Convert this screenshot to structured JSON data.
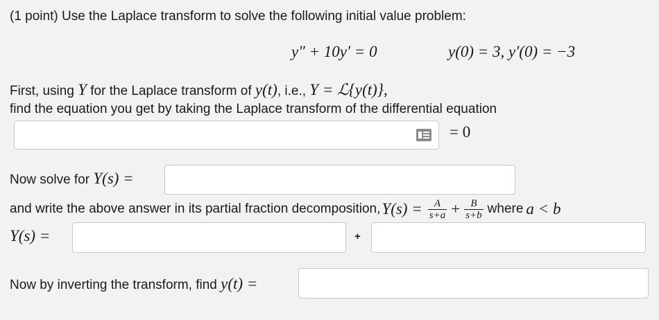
{
  "problem": {
    "intro": "(1 point) Use the Laplace transform to solve the following initial value problem:",
    "ode": "y″ + 10y′ = 0",
    "initial_conditions": "y(0) = 3,  y′(0) = −3"
  },
  "step1": {
    "line1_a": "First, using ",
    "Y": "Y",
    "line1_b": " for the Laplace transform of ",
    "yt": "y(t)",
    "line1_c": ", i.e., ",
    "def": "Y = ℒ{y(t)},",
    "line2": "find the equation you get by taking the Laplace transform of the differential equation",
    "equals_zero": "= 0",
    "input_value": ""
  },
  "step2": {
    "label_text": "Now solve for ",
    "label_math": "Y(s) =",
    "input_value": ""
  },
  "step3": {
    "text_a": "and write the above answer in its partial fraction decomposition, ",
    "Ys_eq": "Y(s) =",
    "frac1_num": "A",
    "frac1_den": "s+a",
    "plus": "+",
    "frac2_num": "B",
    "frac2_den": "s+b",
    "where_text": "where ",
    "condition": "a < b",
    "row_label": "Y(s) =",
    "plus_between": "+",
    "input1_value": "",
    "input2_value": ""
  },
  "step4": {
    "label_text": "Now by inverting the transform, find ",
    "label_math": "y(t) =",
    "input_value": ""
  },
  "icons": {
    "equation_editor": "equation-editor-icon"
  },
  "colors": {
    "background": "#f2f2f2",
    "field_border": "#c9c9c9",
    "icon_gray": "#8a8a8a"
  }
}
